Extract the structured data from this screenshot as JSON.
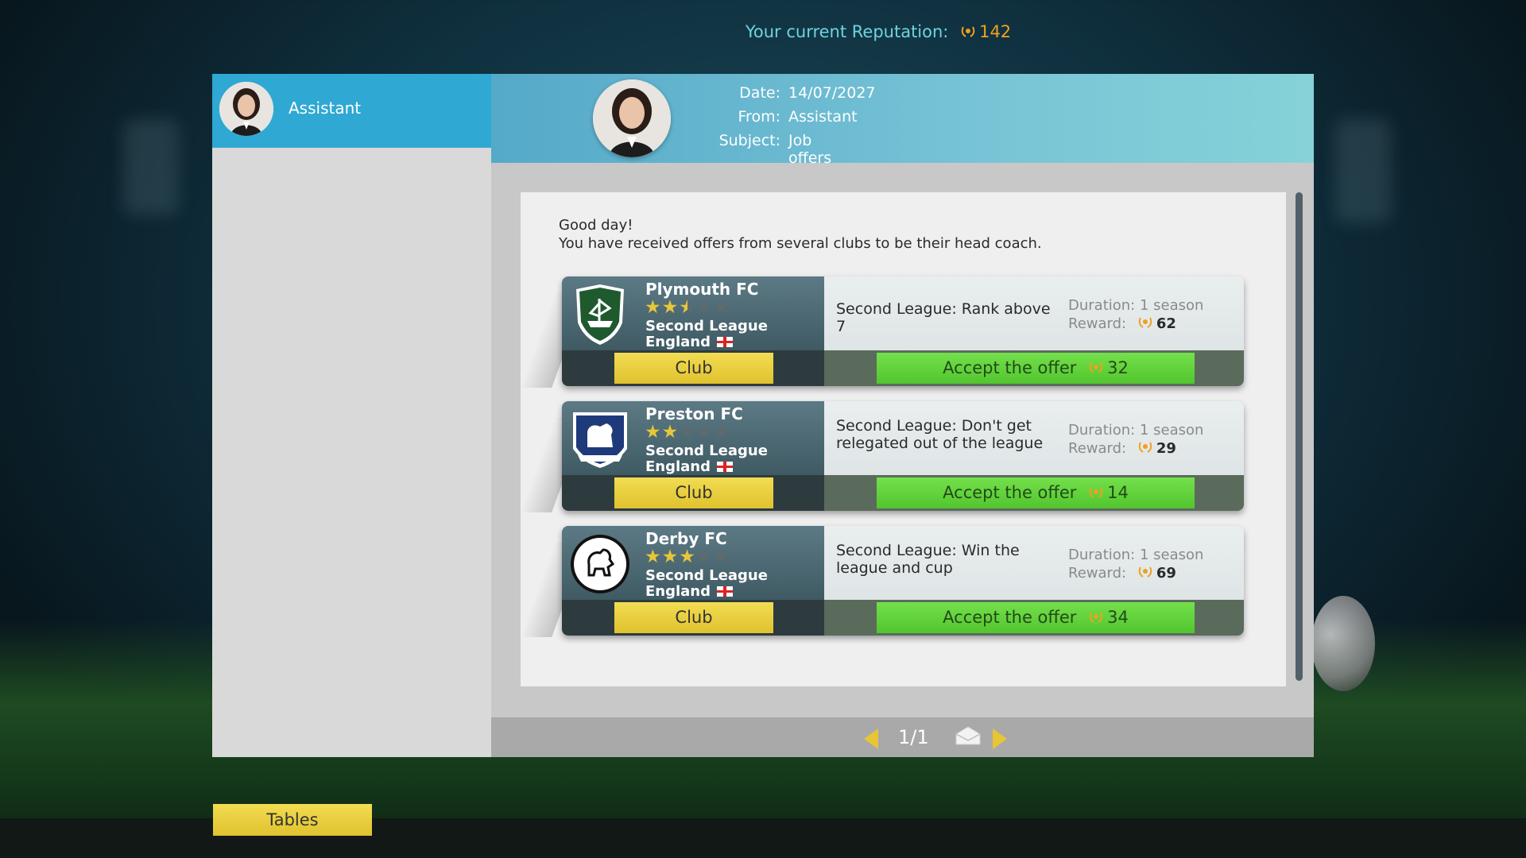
{
  "reputation": {
    "label": "Your current Reputation:",
    "value": "142"
  },
  "sidebar": {
    "items": [
      {
        "label": "Assistant",
        "selected": true
      }
    ]
  },
  "message": {
    "date_label": "Date:",
    "date": "14/07/2027",
    "from_label": "From:",
    "from": "Assistant",
    "subject_label": "Subject:",
    "subject": "Job offers",
    "greeting": "Good day!",
    "body": "You have received offers from several clubs to be their head coach."
  },
  "offers": [
    {
      "club": "Plymouth FC",
      "stars": 2.5,
      "stars_display": [
        "on",
        "on",
        "half",
        "off",
        "off"
      ],
      "league": "Second League",
      "country": "England",
      "club_button": "Club",
      "goal": "Second League: Rank above 7",
      "duration": "Duration: 1 season",
      "reward_label": "Reward:",
      "reward": "62",
      "accept_label": "Accept the offer",
      "cost": "32",
      "crest_color": "#1f5a2f"
    },
    {
      "club": "Preston FC",
      "stars": 2,
      "stars_display": [
        "on",
        "on",
        "off",
        "off",
        "off"
      ],
      "league": "Second League",
      "country": "England",
      "club_button": "Club",
      "goal": "Second League: Don't get relegated out of the league",
      "duration": "Duration: 1 season",
      "reward_label": "Reward:",
      "reward": "29",
      "accept_label": "Accept the offer",
      "cost": "14",
      "crest_color": "#1e3a7a"
    },
    {
      "club": "Derby FC",
      "stars": 3,
      "stars_display": [
        "on",
        "on",
        "on",
        "off",
        "off"
      ],
      "league": "Second League",
      "country": "England",
      "club_button": "Club",
      "goal": "Second League: Win the league and cup",
      "duration": "Duration: 1 season",
      "reward_label": "Reward:",
      "reward": "69",
      "accept_label": "Accept the offer",
      "cost": "34",
      "crest_color": "#111111"
    }
  ],
  "pagination": {
    "page": "1/1"
  },
  "footer": {
    "tables_label": "Tables"
  },
  "colors": {
    "accent_blue": "#2fa8d3",
    "yellow_button": "#e8cc3a",
    "green_button": "#5fd13a",
    "reputation_text": "#6fd3e0"
  },
  "icons": {
    "reputation": "laurel-icon",
    "mail": "envelope-icon",
    "prev": "triangle-left-icon",
    "next": "triangle-right-icon",
    "flag": "england-flag-icon"
  }
}
